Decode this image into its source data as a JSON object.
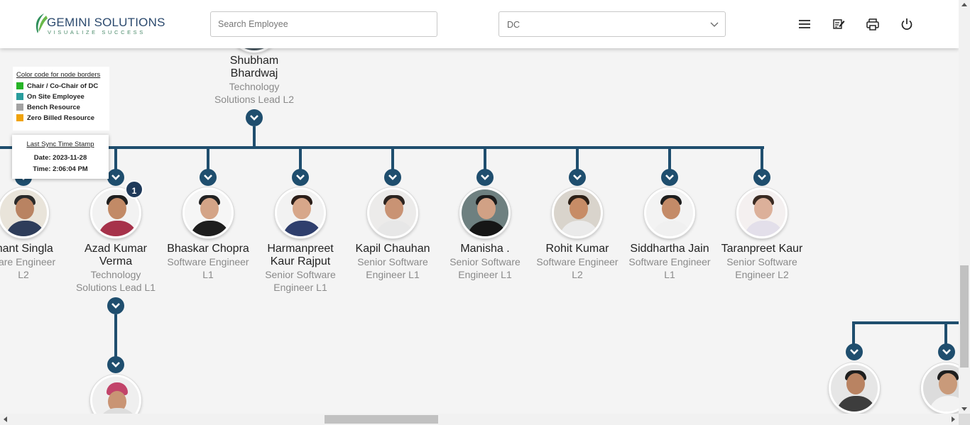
{
  "header": {
    "logo_name": "GEMINI SOLUTIONS",
    "logo_tagline": "VISUALIZE SUCCESS",
    "search_placeholder": "Search Employee",
    "department_value": "DC",
    "icons": [
      "menu-icon",
      "edit-note-icon",
      "print-icon",
      "power-icon"
    ]
  },
  "legend": {
    "title": "Color code for node borders",
    "items": [
      {
        "label": "Chair / Co-Chair of DC",
        "color": "#27b427"
      },
      {
        "label": "On Site Employee",
        "color": "#2a9d9d"
      },
      {
        "label": "Bench Resource",
        "color": "#a3a3a3"
      },
      {
        "label": "Zero Billed Resource",
        "color": "#f0a30a"
      }
    ]
  },
  "sync": {
    "title": "Last Sync Time Stamp",
    "date": "Date: 2023-11-28",
    "time": "Time: 2:06:04 PM"
  },
  "manager": {
    "name_line1": "Shubham",
    "name_line2": "Bhardwaj",
    "title_line1": "Technology",
    "title_line2": "Solutions Lead L2"
  },
  "reports": [
    {
      "name1": "ihant Singla",
      "name2": "",
      "title1": "ware Engineer",
      "title2": "L2"
    },
    {
      "name1": "Azad Kumar",
      "name2": "Verma",
      "title1": "Technology",
      "title2": "Solutions Lead L1",
      "badge": "1"
    },
    {
      "name1": "Bhaskar Chopra",
      "name2": "",
      "title1": "Software Engineer",
      "title2": "L1"
    },
    {
      "name1": "Harmanpreet",
      "name2": "Kaur Rajput",
      "title1": "Senior Software",
      "title2": "Engineer L1"
    },
    {
      "name1": "Kapil Chauhan",
      "name2": "",
      "title1": "Senior Software",
      "title2": "Engineer L1"
    },
    {
      "name1": "Manisha .",
      "name2": "",
      "title1": "Senior Software",
      "title2": "Engineer L1"
    },
    {
      "name1": "Rohit Kumar",
      "name2": "",
      "title1": "Software Engineer",
      "title2": "L2"
    },
    {
      "name1": "Siddhartha Jain",
      "name2": "",
      "title1": "Software Engineer",
      "title2": "L1"
    },
    {
      "name1": "Taranpreet Kaur",
      "name2": "",
      "title1": "Senior Software",
      "title2": "Engineer L2"
    }
  ]
}
